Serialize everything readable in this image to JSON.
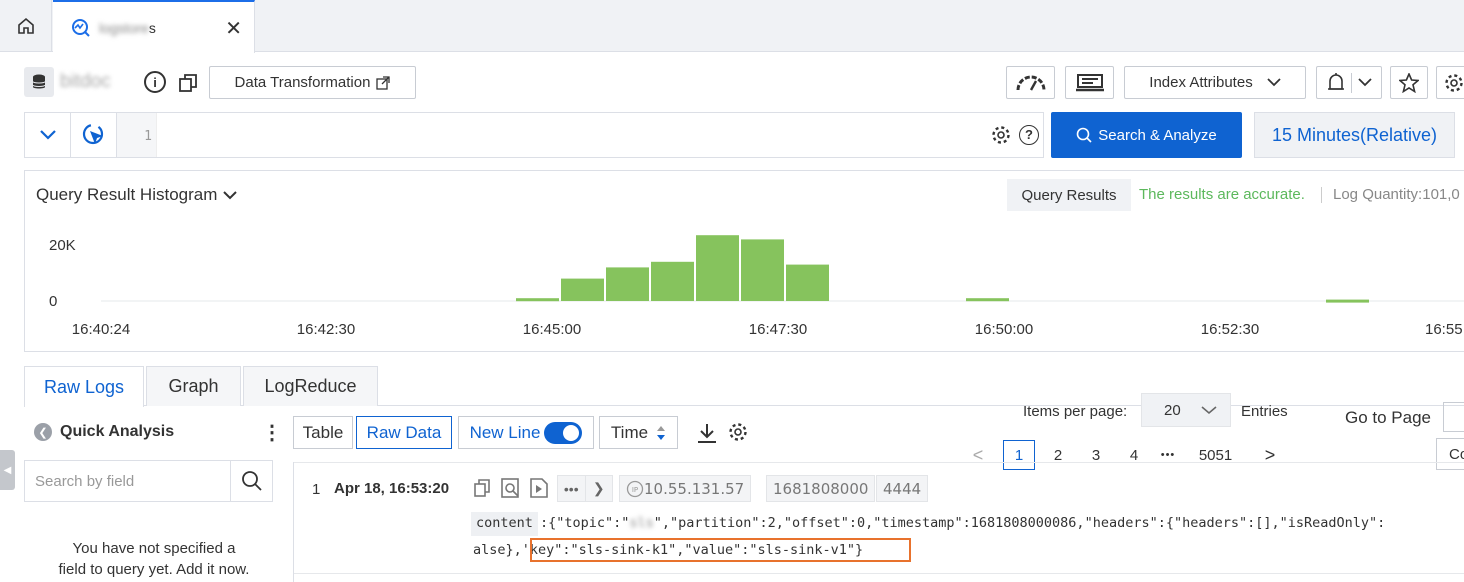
{
  "tabs": {
    "home_icon": "home-icon",
    "active_label": "s",
    "active_icon": "trend-search-icon",
    "close_glyph": "✕"
  },
  "toolbar": {
    "logstore_name": "bitdoc",
    "data_transformation_label": "Data Transformation",
    "index_attributes_label": "Index Attributes"
  },
  "query": {
    "line_number": "1",
    "search_button_label": "Search & Analyze",
    "time_range_label": "15 Minutes(Relative)"
  },
  "histogram": {
    "title": "Query Result Histogram",
    "query_results_label": "Query Results",
    "accuracy_text": "The results are accurate.",
    "log_quantity_text": "Log Quantity:101,0"
  },
  "chart_data": {
    "type": "bar",
    "ylabels": [
      "20K",
      "0"
    ],
    "ylim": [
      0,
      25000
    ],
    "xticks": [
      "16:40:24",
      "16:42:30",
      "16:45:00",
      "16:47:30",
      "16:50:00",
      "16:52:30",
      "16:55"
    ],
    "bars": [
      {
        "start": "16:45:00",
        "value": 1000
      },
      {
        "start": "16:45:30",
        "value": 8000
      },
      {
        "start": "16:46:00",
        "value": 12000
      },
      {
        "start": "16:46:30",
        "value": 14000
      },
      {
        "start": "16:47:00",
        "value": 23500
      },
      {
        "start": "16:47:30",
        "value": 22000
      },
      {
        "start": "16:48:00",
        "value": 13000
      },
      {
        "start": "16:50:00",
        "value": 1000
      },
      {
        "start": "16:54:00",
        "value": 500
      }
    ],
    "bar_color": "#86c35d"
  },
  "subtabs": [
    "Raw Logs",
    "Graph",
    "LogReduce"
  ],
  "quick_analysis": {
    "title": "Quick Analysis",
    "search_placeholder": "Search by field",
    "empty_text_line1": "You have not specified a",
    "empty_text_line2": "field to query yet. Add it now."
  },
  "raw_controls": {
    "table_label": "Table",
    "raw_data_label": "Raw Data",
    "new_line_label": "New Line",
    "new_line_enabled": true,
    "time_label": "Time",
    "items_per_page_label": "Items per page:",
    "items_per_page_value": "20",
    "entries_label": "Entries",
    "go_to_page_label": "Go to Page",
    "go_button_label": "Co"
  },
  "pagination": {
    "prev": "<",
    "pages": [
      "1",
      "2",
      "3",
      "4",
      "•••",
      "5051"
    ],
    "next": ">"
  },
  "log_entry": {
    "index": "1",
    "time": "Apr 18, 16:53:20",
    "ip": "10.55.131.57",
    "tag_timestamp": "1681808000",
    "tag_port": "4444",
    "content_key": "content",
    "content_prefix": ":{\"topic\":\"",
    "content_topic": "sls",
    "content_rest": "\",\"partition\":2,\"offset\":0,\"timestamp\":1681808000086,\"headers\":{\"headers\":[],\"isReadOnly\":",
    "content_line2_start": "alse},'",
    "content_line2_highlight": "key\":\"sls-sink-k1\",\"value\":\"sls-sink-v1\"}",
    "highlight_color": "#e8722d"
  },
  "colors": {
    "primary": "#0f63d1",
    "success": "#5cb85c"
  }
}
